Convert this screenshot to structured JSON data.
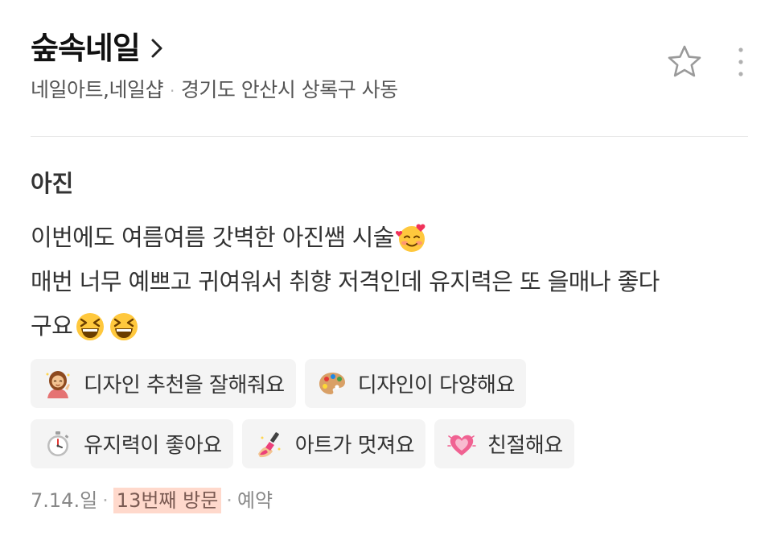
{
  "place": {
    "name": "숲속네일",
    "category": "네일아트,네일샵",
    "address": "경기도 안산시 상록구 사동"
  },
  "icons": {
    "chevron": "chevron-right-icon",
    "favorite": "star-outline-icon",
    "more": "more-vertical-icon"
  },
  "review": {
    "author": "아진",
    "lines": [
      "이번에도 여름여름 갓벽한 아진쌤 시술",
      "매번 너무 예쁘고 귀여워서 취향 저격인데 유지력은 또 을매나 좋다",
      "구요"
    ],
    "emojis": [
      "smiling-face-with-hearts-icon",
      "grinning-squinting-face-icon",
      "grinning-squinting-face-icon"
    ]
  },
  "keywords": [
    {
      "label": "디자인 추천을 잘해줘요",
      "icon": "woman-tipping-hand-icon"
    },
    {
      "label": "디자인이 다양해요",
      "icon": "artist-palette-icon"
    },
    {
      "label": "유지력이 좋아요",
      "icon": "stopwatch-icon"
    },
    {
      "label": "아트가 멋져요",
      "icon": "nail-polish-icon"
    },
    {
      "label": "친절해요",
      "icon": "growing-heart-icon"
    }
  ],
  "footer": {
    "date": "7.14.일",
    "visit_count": "13번째 방문",
    "visit_type": "예약"
  },
  "colors": {
    "visit_badge_bg": "#ffd9cc",
    "chip_bg": "#f4f4f4",
    "divider": "#e6e6e6"
  }
}
